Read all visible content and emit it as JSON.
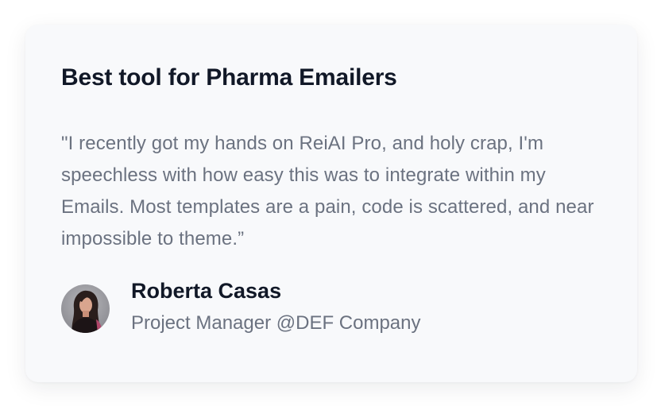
{
  "testimonial": {
    "title": "Best tool for Pharma Emailers",
    "quote": "\"I recently got my hands on ReiAI Pro, and holy crap, I'm speechless with how easy this was to integrate within my Emails. Most templates are a pain, code is scattered, and near impossible to theme.”",
    "author": {
      "name": "Roberta Casas",
      "role": "Project Manager @DEF Company",
      "avatar": "avatar-photo"
    }
  },
  "colors": {
    "card_background": "#f8f9fb",
    "title": "#111827",
    "muted_text": "#6b7280"
  }
}
